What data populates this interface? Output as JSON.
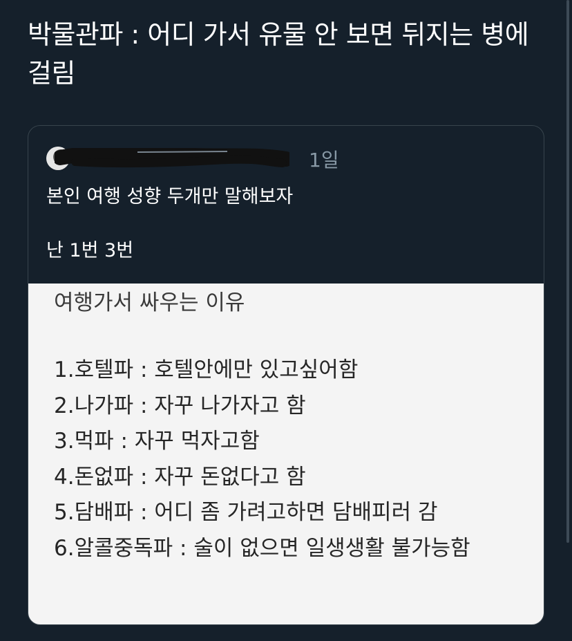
{
  "tweet": {
    "text": "박물관파 : 어디 가서 유물 안 보면 뒤지는 병에 걸림"
  },
  "quote": {
    "time": "1일",
    "body_line1": "본인 여행 성향 두개만 말해보자",
    "body_line2": "난 1번 3번",
    "image": {
      "title": "여행가서 싸우는 이유",
      "items": [
        "1.호텔파 : 호텔안에만 있고싶어함",
        "2.나가파 : 자꾸 나가자고 함",
        "3.먹파 : 자꾸 먹자고함",
        "4.돈없파 : 자꾸 돈없다고 함",
        "5.담배파 : 어디 좀 가려고하면 담배피러 감",
        "6.알콜중독파 : 술이 없으면 일생생활 불가능함"
      ]
    }
  },
  "colors": {
    "background": "#15202b",
    "card_border": "#38444d",
    "secondary_text": "#8899a6",
    "image_background": "#f4f4f4"
  },
  "icons": {
    "avatar": "avatar-icon",
    "redaction": "redaction-scribble"
  }
}
